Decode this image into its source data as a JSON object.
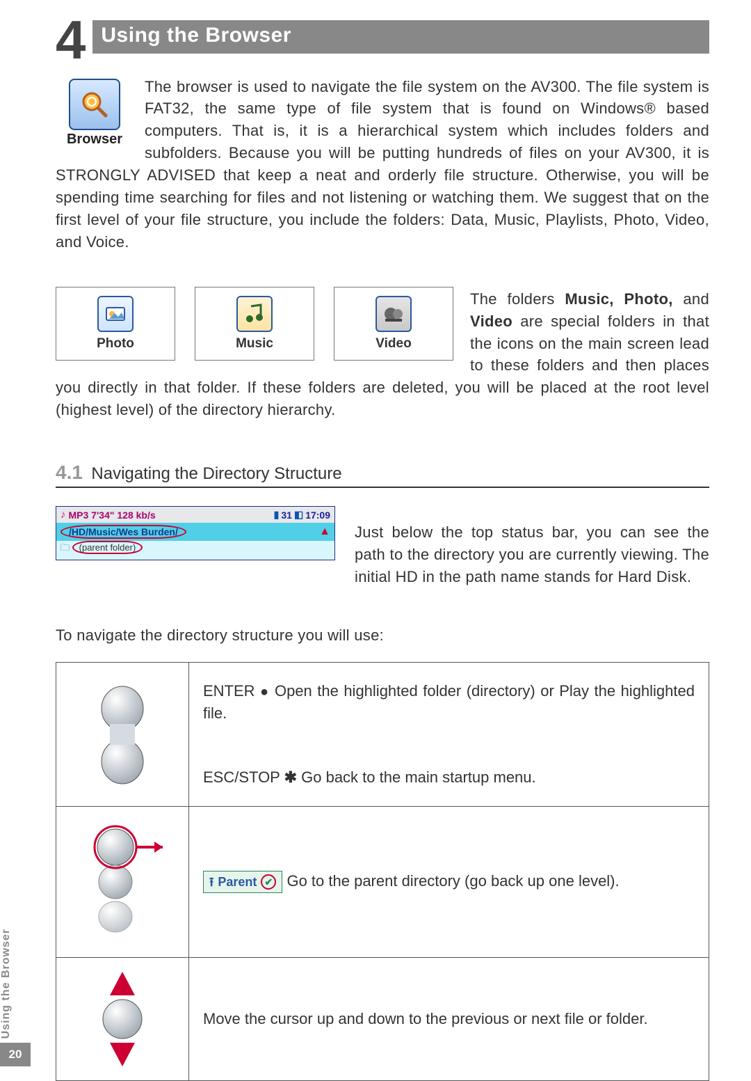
{
  "section": {
    "number": "4",
    "title": "Using the Browser"
  },
  "browser_label": "Browser",
  "para1": "The browser is used to navigate the file system on the AV300. The file system is FAT32, the same type of file system that is found on Windows® based computers. That is, it is a hierarchical system which includes folders and subfolders. Because you will be putting hundreds of files on your AV300, it is STRONGLY ADVISED that keep a neat and orderly file structure. Otherwise, you will be spending time searching for files and not listening or watching them. We suggest that on the first level of your file structure, you include the folders: Data, Music, Playlists, Photo, Video, and Voice.",
  "folders": {
    "photo": "Photo",
    "music": "Music",
    "video": "Video"
  },
  "para2_lead": "The folders ",
  "para2_bold": "Music, Photo,",
  "para2_mid": " and ",
  "para2_bold2": "Video",
  "para2_rest": " are special folders in that the icons on the main screen lead to these folders and then places you directly in that folder. If these folders are deleted, you will be placed at the root level (highest level) of the directory hierarchy.",
  "subsection": {
    "number": "4.1",
    "title": "Navigating the Directory Structure"
  },
  "dirshot": {
    "status_left": "MP3 7'34\" 128 kb/s",
    "status_right_a": "31",
    "status_right_b": "17:09",
    "path": "/HD/Music/Wes Burden/",
    "parent": "(parent folder)"
  },
  "para3": "Just below the top status bar, you can see the path to the directory you are currently viewing. The initial HD in the path name stands for Hard Disk.",
  "para4": "To navigate the directory structure you will use:",
  "nav": {
    "r1_enter_label": "ENTER",
    "r1_enter_desc": " Open the highlighted folder (directory) or Play the highlighted file.",
    "r1_esc_label": "ESC/STOP",
    "r1_esc_desc": " Go back to the main startup menu.",
    "r2_parent_label": "Parent",
    "r2_desc": " Go to the parent directory (go back up one level).",
    "r3_desc": "Move the cursor up and down to the previous or next file or folder."
  },
  "footer": {
    "tab": "Using the Browser",
    "page": "20"
  }
}
